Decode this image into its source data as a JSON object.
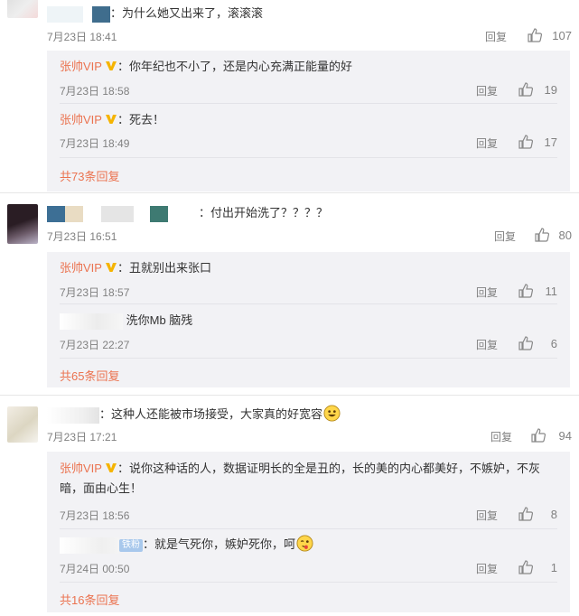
{
  "colors": {
    "accent": "#eb7350",
    "meta": "#808080",
    "sub_bg": "#f2f2f5",
    "vip_badge": "#f5b400"
  },
  "threads": [
    {
      "comment": {
        "text": "：为什么她又出来了，滚滚滚",
        "time": "7月23日 18:41",
        "reply": "回复",
        "likes": "107"
      },
      "replies": [
        {
          "name": "张帅VIP",
          "text": "：你年纪也不小了，还是内心充满正能量的好",
          "time": "7月23日 18:58",
          "reply": "回复",
          "likes": "19"
        },
        {
          "name": "张帅VIP",
          "text": "：死去！",
          "time": "7月23日 18:49",
          "reply": "回复",
          "likes": "17"
        }
      ],
      "more": "共73条回复"
    },
    {
      "comment": {
        "text": "：付出开始洗了？？？？",
        "time": "7月23日 16:51",
        "reply": "回复",
        "likes": "80"
      },
      "replies": [
        {
          "name": "张帅VIP",
          "text": "：丑就别出来张口",
          "time": "7月23日 18:57",
          "reply": "回复",
          "likes": "11"
        },
        {
          "name": "",
          "text": "洗你Mb 脑残",
          "time": "7月23日 22:27",
          "reply": "回复",
          "likes": "6"
        }
      ],
      "more": "共65条回复"
    },
    {
      "comment": {
        "text": "：这种人还能被市场接受，大家真的好宽容",
        "time": "7月23日 17:21",
        "reply": "回复",
        "likes": "94"
      },
      "replies": [
        {
          "name": "张帅VIP",
          "text_line1": "：说你这种话的人，数据证明长的全是丑的，长的美的内心都美好，不嫉妒，不灰",
          "text_line2": "暗，面由心生！",
          "time": "7月23日 18:56",
          "reply": "回复",
          "likes": "8"
        },
        {
          "name": "",
          "badge": "铁粉",
          "text": "：就是气死你，嫉妒死你，呵",
          "time": "7月24日 00:50",
          "reply": "回复",
          "likes": "1"
        }
      ],
      "more": "共16条回复"
    }
  ]
}
